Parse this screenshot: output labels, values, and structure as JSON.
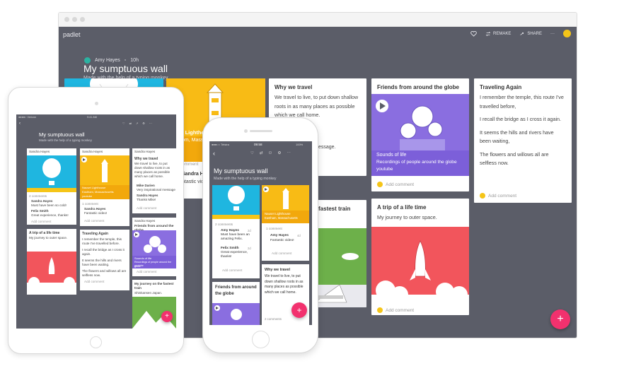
{
  "desktop": {
    "brand": "padlet",
    "nav": {
      "remake": "REMAKE",
      "share": "SHARE",
      "more": "···"
    },
    "author": "Amy Hayes",
    "age": "10h",
    "title": "My sumptuous wall",
    "subtitle": "Made with the help of a typing monkey",
    "fab": "+",
    "cards": {
      "lighthouse_peek": "t Lighthou",
      "lighthouse_peek2": "om, Massa",
      "why_travel": {
        "title": "Why we travel",
        "body": "We travel to live, to put down shallow roots in as many places as possible which we call home.",
        "peek": "essage."
      },
      "fastest_train_peek": "fastest train",
      "friends": {
        "title": "Friends from around the globe",
        "caption_title": "Sounds of life",
        "caption_body": "Recordings of people around the globe",
        "caption_source": "youtube",
        "comment": "Add comment"
      },
      "trip": {
        "title": "A trip of a life time",
        "body": "My journey to outer space.",
        "comment": "Add comment"
      },
      "traveling": {
        "title": "Traveling Again",
        "lines": [
          "I remember the temple, this route I've travelled before,",
          "I recall the bridge as I cross it again.",
          "It seems the hills and rivers have been waiting,",
          "The flowers and willows all are selfless now."
        ],
        "comment": "Add comment"
      },
      "mid_peek": {
        "name": "Sandra Hayes",
        "tic": "ntastic vid",
        "comment": "omment"
      }
    }
  },
  "tablet": {
    "status_left": "●●●●○ Verizon",
    "status_time": "9:41 AM",
    "title": "My sumptuous wall",
    "subtitle": "Made with the help of a typing monkey",
    "col1": {
      "author": "Sandra Hayes",
      "comments": "2 comments",
      "c1_name": "Sandra Hayes",
      "c1_text": "Must have been so cold!",
      "c2_name": "Felix Smith",
      "c2_text": "Great experience, thanks!",
      "add": "Add comment",
      "trip_title": "A trip of a life time",
      "trip_body": "My journey to outer space."
    },
    "col2": {
      "author": "Sandra Hayes",
      "caption_title": "Nauset Lighthouse",
      "caption_body": "Eastham, Massachusetts",
      "caption_source": "youtube",
      "comments": "1 comment",
      "c1_name": "Sandra Hayes",
      "c1_text": "Fantastic video!",
      "add": "Add comment",
      "trav_title": "Traveling Again",
      "trav_l1": "I remember the temple, this route I've travelled before.",
      "trav_l2": "I recall the bridge as I cross it again.",
      "trav_l3": "It seems the hills and rivers have been waiting.",
      "trav_l4": "The flowers and willows all are selfless now.",
      "add2": "Add comment"
    },
    "col3": {
      "author": "Sandra Hayes",
      "why_title": "Why we travel",
      "why_body": "We travel to live, to put down shallow roots in as many places as possible which we call home.",
      "c1_name": "Mike Darien",
      "c1_text": "Very inspirational message",
      "c2_name": "Sandra Hayes",
      "c2_text": "Thanks Mike!",
      "add": "Add comment",
      "author2": "Sandra Hayes",
      "friends_title": "Friends from around the globe",
      "sounds_title": "Sounds of life",
      "sounds_body": "Recordings of people around the globe",
      "sounds_source": "youtube",
      "add2": "Add comment",
      "train_title": "My journey on the fastest train",
      "train_body": "Shinkansen Japan."
    },
    "fab": "+"
  },
  "phone": {
    "carrier": "●●●○○ Telstra",
    "time": "09:58",
    "battery": "100%",
    "title": "My sumptuous wall",
    "subtitle": "Made with the help of a typing monkey",
    "col1": {
      "comments": "2 comments",
      "c1_name": "Amy Hayes",
      "c1_age": "2d",
      "c1_text": "Must have been an amazing Felix.",
      "c2_name": "Felix Smith",
      "c2_age": "2d",
      "c2_text": "Great experience, thanks!",
      "add": "Add comment",
      "friends_title": "Friends from around the globe"
    },
    "col2": {
      "caption_title": "Nauset Lighthouse",
      "caption_body": "Eastham, Massachusetts",
      "comments": "1 comment",
      "c1_name": "Amy Hayes",
      "c1_age": "4d",
      "c1_text": "Fantastic video!",
      "add": "Add comment",
      "why_title": "Why we travel",
      "why_body": "We travel to live, to put down shallow roots in as many places as possible which we call home.",
      "comments2": "2 comments"
    },
    "fab": "+"
  }
}
